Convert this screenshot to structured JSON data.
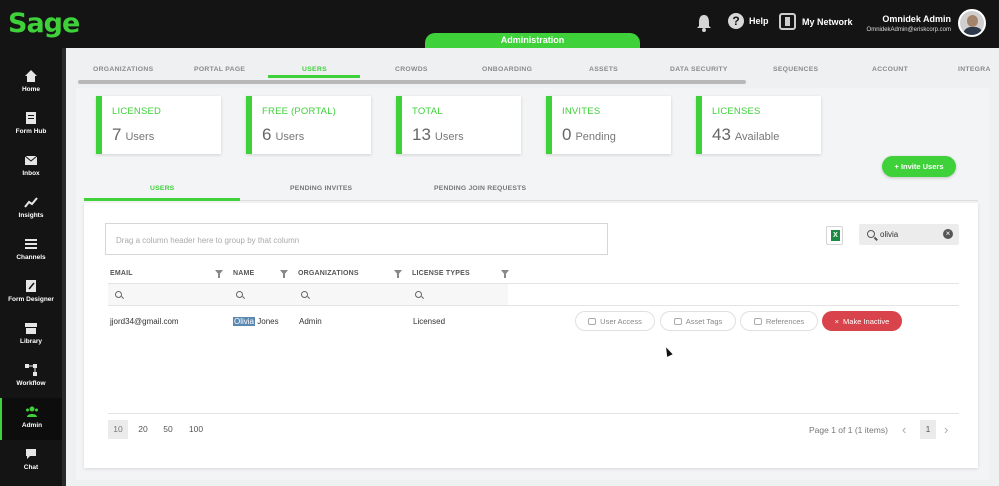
{
  "app": {
    "logo": "Sage",
    "section": "Administration"
  },
  "header": {
    "help_label": "Help",
    "network_label": "My Network",
    "user_name": "Omnidek Admin",
    "user_email": "OmnidekAdmin@eriskcorp.com"
  },
  "sidebar": {
    "items": [
      {
        "label": "Home",
        "icon": "home-icon"
      },
      {
        "label": "Form Hub",
        "icon": "form-hub-icon"
      },
      {
        "label": "Inbox",
        "icon": "inbox-icon"
      },
      {
        "label": "Insights",
        "icon": "insights-icon"
      },
      {
        "label": "Channels",
        "icon": "channels-icon"
      },
      {
        "label": "Form Designer",
        "icon": "form-designer-icon"
      },
      {
        "label": "Library",
        "icon": "library-icon"
      },
      {
        "label": "Workflow",
        "icon": "workflow-icon"
      },
      {
        "label": "Admin",
        "icon": "admin-icon",
        "active": true
      },
      {
        "label": "Chat",
        "icon": "chat-icon"
      }
    ]
  },
  "tabs": [
    "ORGANIZATIONS",
    "PORTAL PAGE",
    "USERS",
    "CROWDS",
    "ONBOARDING",
    "ASSETS",
    "DATA SECURITY",
    "SEQUENCES",
    "ACCOUNT",
    "INTEGRA"
  ],
  "active_tab": "USERS",
  "stats": [
    {
      "title": "LICENSED",
      "value": "7",
      "unit": "Users"
    },
    {
      "title": "FREE (PORTAL)",
      "value": "6",
      "unit": "Users"
    },
    {
      "title": "TOTAL",
      "value": "13",
      "unit": "Users"
    },
    {
      "title": "INVITES",
      "value": "0",
      "unit": "Pending"
    },
    {
      "title": "LICENSES",
      "value": "43",
      "unit": "Available"
    }
  ],
  "invite_button": "+ Invite Users",
  "subtabs": [
    "USERS",
    "PENDING INVITES",
    "PENDING JOIN REQUESTS"
  ],
  "grid": {
    "group_placeholder": "Drag a column header here to group by that column",
    "search_value": "olivia",
    "columns": [
      "EMAIL",
      "NAME",
      "ORGANIZATIONS",
      "LICENSE TYPES"
    ],
    "rows": [
      {
        "email": "jjord34@gmail.com",
        "name_highlight": "Olivia",
        "name_rest": " Jones",
        "organization": "Admin",
        "license_type": "Licensed"
      }
    ],
    "row_actions": [
      "User Access",
      "Asset Tags",
      "References",
      "Make Inactive"
    ]
  },
  "pager": {
    "sizes": [
      "10",
      "20",
      "50",
      "100"
    ],
    "selected_size": "10",
    "info": "Page 1 of 1 (1 items)",
    "current_page": "1",
    "prev": "‹",
    "next": "›"
  },
  "colors": {
    "brand": "#3ed13a",
    "danger": "#d9434b",
    "topbar": "#141414"
  }
}
